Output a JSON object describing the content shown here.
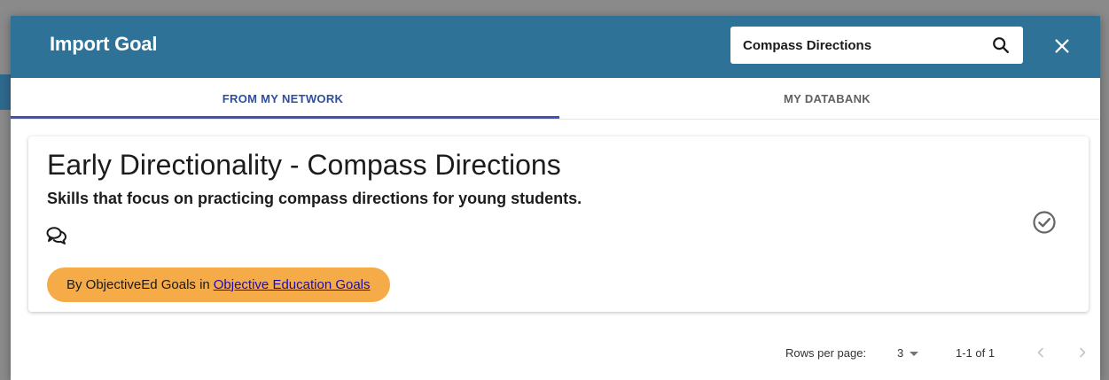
{
  "dialog": {
    "title": "Import Goal",
    "search": {
      "value": "Compass Directions",
      "icon": "search-icon"
    },
    "close_icon": "close-icon",
    "header_color": "#2f7298"
  },
  "tabs": [
    {
      "label": "FROM MY NETWORK",
      "active": true
    },
    {
      "label": "MY DATABANK",
      "active": false
    }
  ],
  "results": [
    {
      "title": "Early Directionality - Compass Directions",
      "description": "Skills that focus on practicing compass directions for young students.",
      "comment_icon": "comments-icon",
      "select_icon": "check-circle-icon",
      "author_prefix": "By ObjectiveEd Goals in",
      "network_link": "Objective Education Goals",
      "badge_color": "#f4ab48"
    }
  ],
  "pagination": {
    "rows_per_page_label": "Rows per page:",
    "rows_per_page": "3",
    "range": "1-1 of 1",
    "prev_icon": "chevron-left-icon",
    "next_icon": "chevron-right-icon"
  }
}
